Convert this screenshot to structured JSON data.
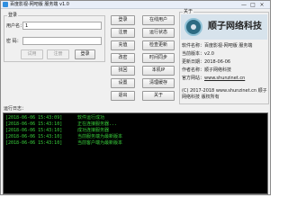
{
  "window": {
    "title": "百度影视-网吧版 服务端 v1.0",
    "minimize_glyph": "—",
    "maximize_glyph": "□",
    "close_glyph": "×"
  },
  "login": {
    "group_label": "登录",
    "username_label": "用户名：",
    "username_value": "1",
    "password_label": "密 码：",
    "password_value": "",
    "trial_button": "试用",
    "register_button": "注册",
    "login_button": "登录"
  },
  "actions": {
    "col1": [
      "登录",
      "注册",
      "充值",
      "改密",
      "找回",
      "设置",
      "退出"
    ],
    "col2": [
      "在线用户",
      "运行状态",
      "检查更新",
      "时间同步",
      "本机IP",
      "清理缓存",
      "关于"
    ]
  },
  "about": {
    "group_label": "关于",
    "logo_text": "顺子网络科技",
    "software_name": "软件名称：百度影视-网吧版 服务端",
    "version": "当前版本：v2.0",
    "update_date": "更新日期：2018-06-06",
    "author": "作者名称：顺子网络科技",
    "website_label": "官方网站：",
    "website_url": "www.shunzinet.cn",
    "copyright_line1": "(C) 2017-2018 www.shunzinet.cn 顺子",
    "copyright_line2": "网络科技 版权所有"
  },
  "log": {
    "label": "运行日志：",
    "entries": [
      {
        "time": "[2018-06-06 15:43:09]",
        "message": "软件运行成功"
      },
      {
        "time": "[2018-06-06 15:43:10]",
        "message": "正在连接服务器..."
      },
      {
        "time": "[2018-06-06 15:43:10]",
        "message": "成功连接服务器"
      },
      {
        "time": "[2018-06-06 15:43:10]",
        "message": "当前服务端为最新版本"
      },
      {
        "time": "[2018-06-06 15:43:10]",
        "message": "当前客户端为最新版本"
      }
    ]
  },
  "colors": {
    "log_text": "#39d43c",
    "log_background": "#000000",
    "window_background": "#f0f0f0"
  }
}
